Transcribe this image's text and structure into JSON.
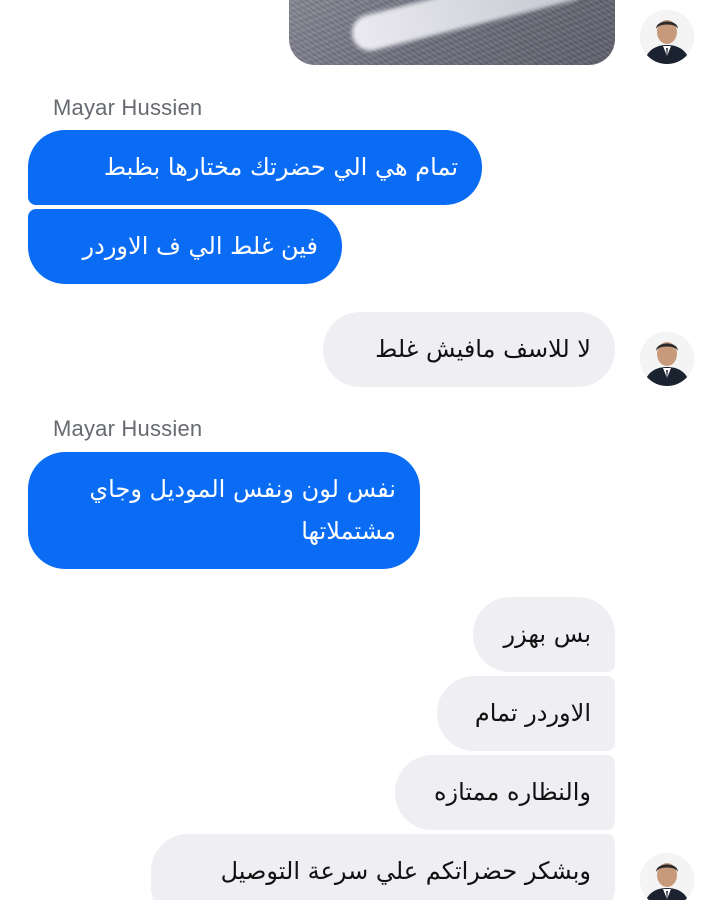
{
  "sender_name": "Mayar Hussien",
  "messages": {
    "m1": "تمام هي الي حضرتك مختارها بظبط",
    "m2": "فين غلط الي ف الاوردر",
    "m3": "لا للاسف مافيش غلط",
    "m4": "نفس لون ونفس الموديل وجاي مشتملاتها",
    "m5": "بس بهزر",
    "m6": "الاوردر تمام",
    "m7": "والنظاره ممتازه",
    "m8": "وبشكر حضراتكم علي سرعة التوصيل"
  },
  "colors": {
    "incoming_bubble": "#0a6cf5",
    "outgoing_bubble": "#efeff3",
    "sender_name": "#666a70"
  }
}
